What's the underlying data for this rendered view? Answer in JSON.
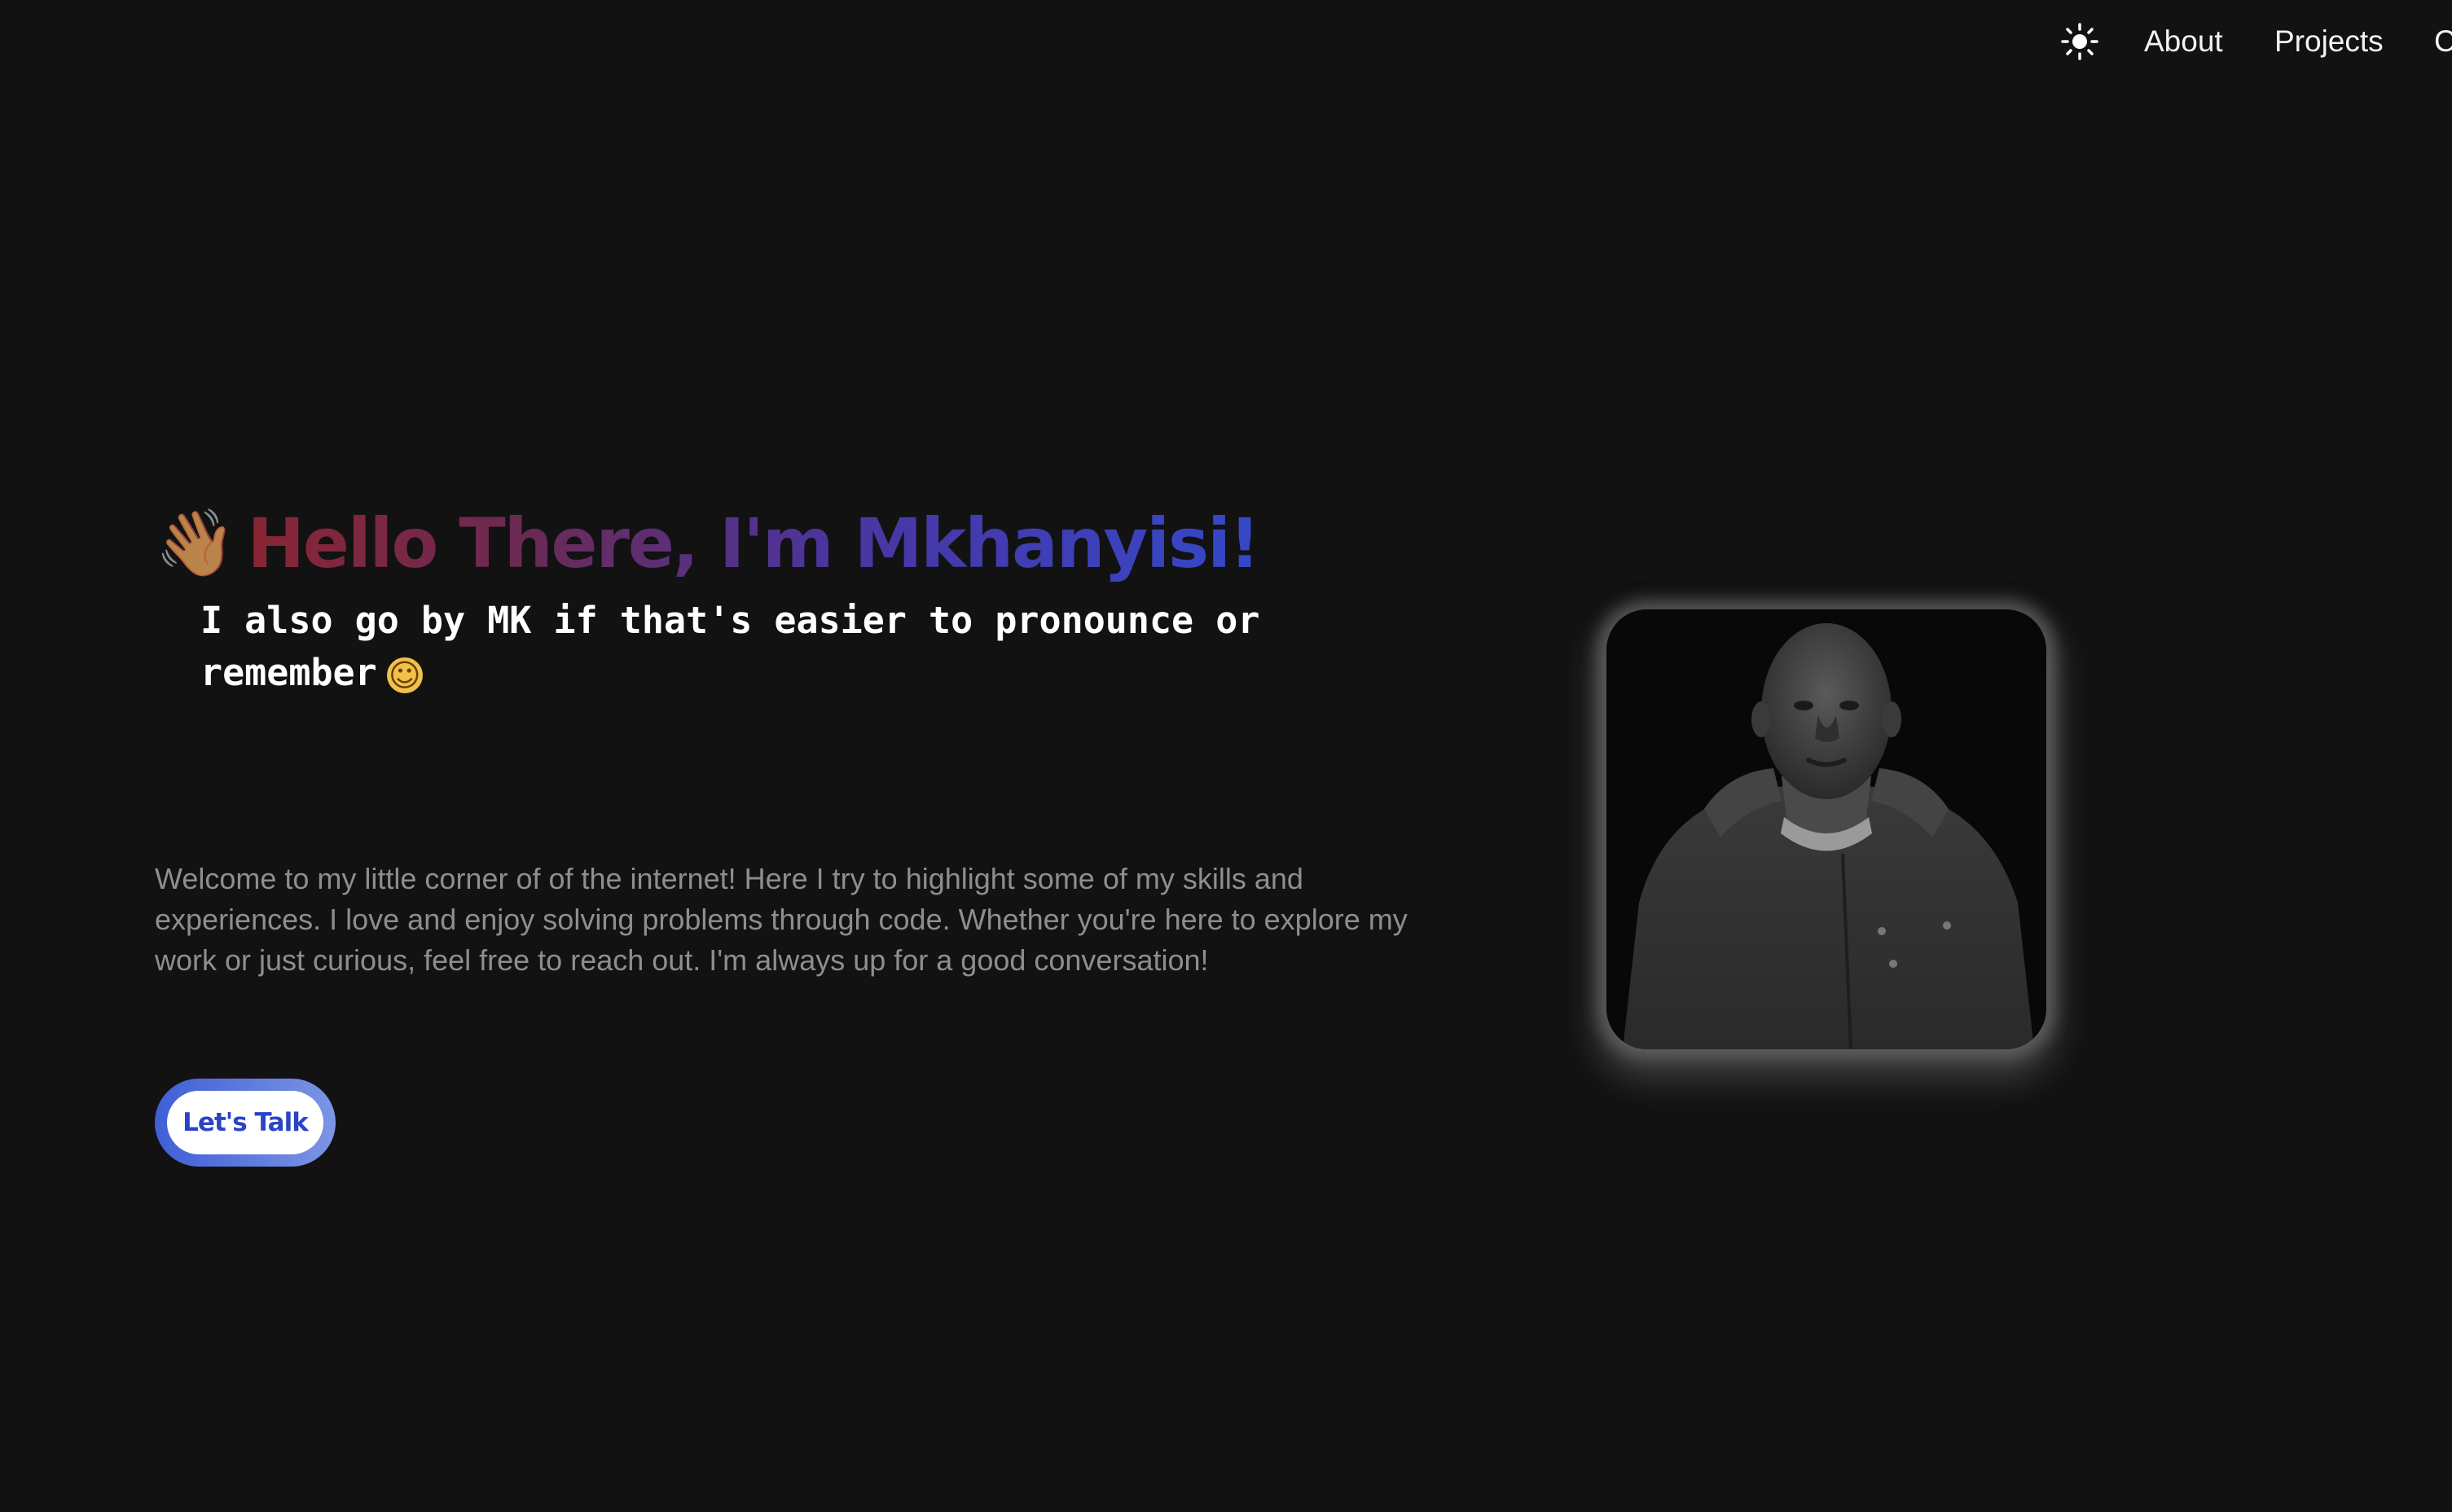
{
  "nav": {
    "theme_toggle_icon": "sun-icon",
    "links": [
      {
        "label": "About"
      },
      {
        "label": "Projects"
      },
      {
        "label": "Contact"
      }
    ]
  },
  "hero": {
    "wave_icon": "waving-hand-icon",
    "title": "Hello There, I'm Mkhanyisi!",
    "subtitle": "I also go by MK if that's easier to pronounce or remember",
    "subtitle_emoji_icon": "grinning-face-icon",
    "intro": "Welcome to my little corner of of the internet! Here I try to highlight some of my skills and experiences. I love and enjoy solving problems through code. Whether you're here to explore my work or just curious, feel free to reach out. I'm always up for a good conversation!",
    "cta_label": "Let's Talk"
  },
  "colors": {
    "background": "#121212",
    "title_gradient_start": "#8a2533",
    "title_gradient_end": "#3448c8",
    "cta_text": "#2a44c9",
    "body_text": "#8e8e8e"
  }
}
